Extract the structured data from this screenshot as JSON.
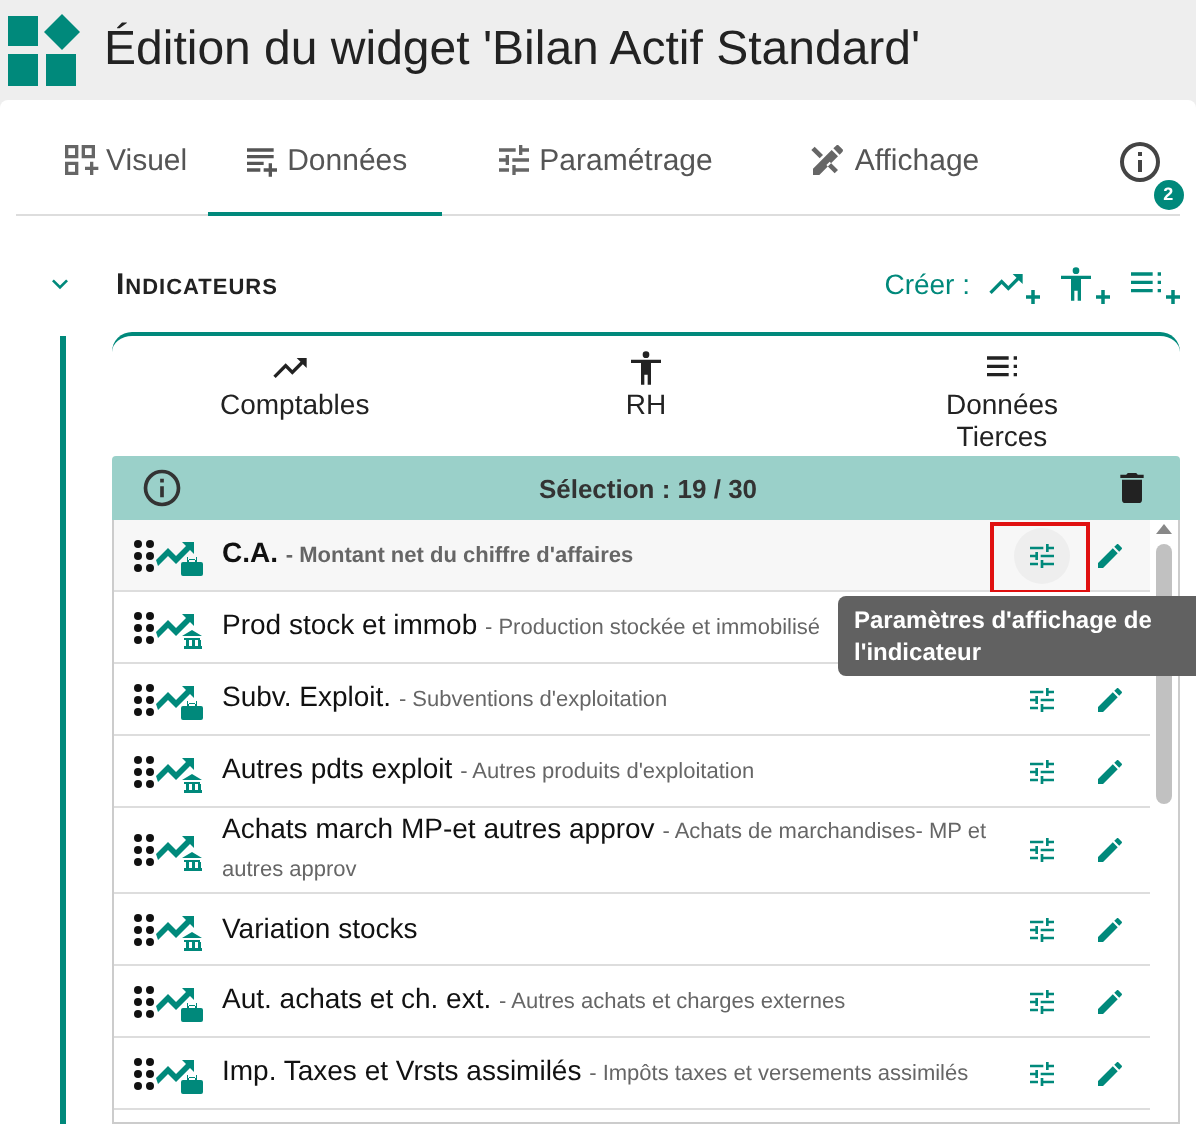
{
  "window": {
    "title": "Édition du widget 'Bilan Actif Standard'"
  },
  "tabs": [
    {
      "label": "Visuel",
      "selected": false
    },
    {
      "label": "Données",
      "selected": true
    },
    {
      "label": "Paramétrage",
      "selected": false
    },
    {
      "label": "Affichage",
      "selected": false
    }
  ],
  "info_badge": "2",
  "section": {
    "title": "Indicateurs",
    "expanded": true,
    "create_label": "Créer :"
  },
  "categories": [
    {
      "label": "Comptables"
    },
    {
      "label": "RH"
    },
    {
      "label": "Données Tierces"
    }
  ],
  "selection": {
    "label": "Sélection : 19 / 30"
  },
  "rows": [
    {
      "name": "C.A.",
      "description": "- Montant net du chiffre d'affaires",
      "kind": "briefcase",
      "hovered": true,
      "highlighted": true,
      "tooltip": "Paramètres d'affichage de l'indicateur"
    },
    {
      "name": "Prod stock et immob",
      "description": "- Production stockée et immobilisé",
      "kind": "bank",
      "hovered": false,
      "highlighted": false
    },
    {
      "name": "Subv. Exploit.",
      "description": "- Subventions d'exploitation",
      "kind": "briefcase",
      "hovered": false,
      "highlighted": false
    },
    {
      "name": "Autres pdts exploit",
      "description": "- Autres produits d'exploitation",
      "kind": "bank",
      "hovered": false,
      "highlighted": false
    },
    {
      "name": "Achats march MP-et autres approv",
      "description": "- Achats de marchandises- MP et autres approv",
      "kind": "bank",
      "hovered": false,
      "highlighted": false
    },
    {
      "name": "Variation stocks",
      "kind": "bank",
      "hovered": false,
      "highlighted": false
    },
    {
      "name": "Aut. achats et ch. ext.",
      "description": "- Autres achats et charges externes",
      "kind": "briefcase",
      "hovered": false,
      "highlighted": false
    },
    {
      "name": "Imp. Taxes et Vrsts assimilés",
      "description": "- Impôts taxes et versements assimilés",
      "kind": "briefcase",
      "hovered": false,
      "highlighted": false
    }
  ]
}
